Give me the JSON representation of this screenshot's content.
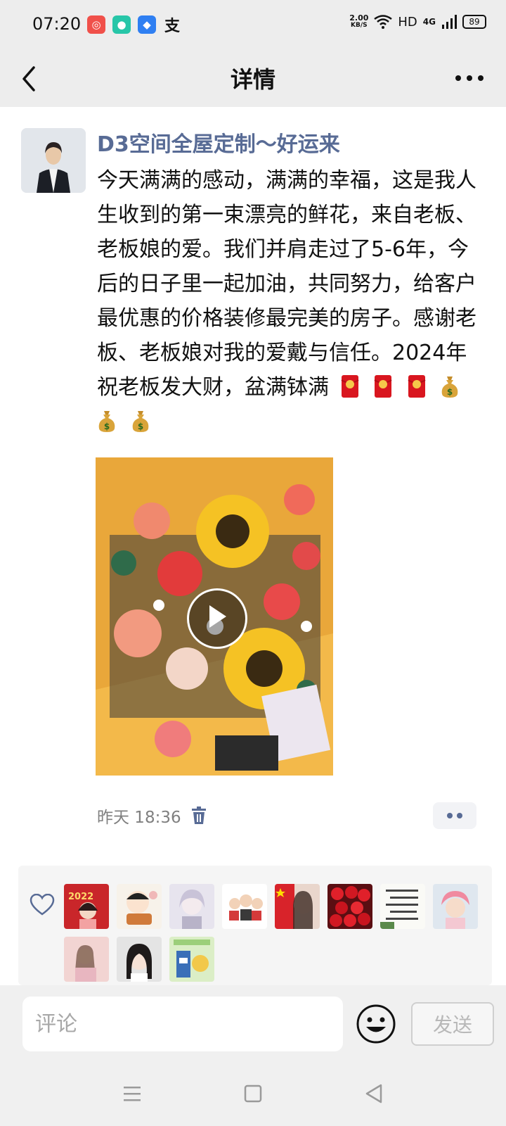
{
  "status": {
    "time": "07:20",
    "net_speed": "2.00",
    "net_unit": "KB/S",
    "network": "HD",
    "signal": "4G",
    "battery": "89"
  },
  "nav": {
    "title": "详情"
  },
  "post": {
    "author": "D3空间全屋定制〜好运来",
    "text": "今天满满的感动，满满的幸福，这是我人生收到的第一束漂亮的鲜花，来自老板、老板娘的爱。我们并肩走过了5-6年，今后的日子里一起加油，共同努力，给客户最优惠的价格装修最完美的房子。感谢老板、老板娘对我的爱戴与信任。2024年祝老板发大财，盆满钵满",
    "emojis": [
      "hongbao-emoji",
      "hongbao-emoji",
      "hongbao-emoji",
      "money-bag-emoji",
      "money-bag-emoji",
      "money-bag-emoji"
    ],
    "timestamp": "昨天 18:36"
  },
  "likes": {
    "count": 11,
    "avatars": [
      "avatar-2022-girl",
      "avatar-cartoon-boy",
      "avatar-anime-girl",
      "avatar-family-cartoon",
      "avatar-flag-girl",
      "avatar-red-roses",
      "avatar-text-poem",
      "avatar-baby",
      "avatar-pink-girl",
      "avatar-woman-portrait",
      "avatar-milk-box"
    ]
  },
  "comment": {
    "placeholder": "评论",
    "send_label": "发送"
  },
  "colors": {
    "author": "#586b95",
    "background": "#ededed",
    "panel": "#f5f5f5"
  }
}
